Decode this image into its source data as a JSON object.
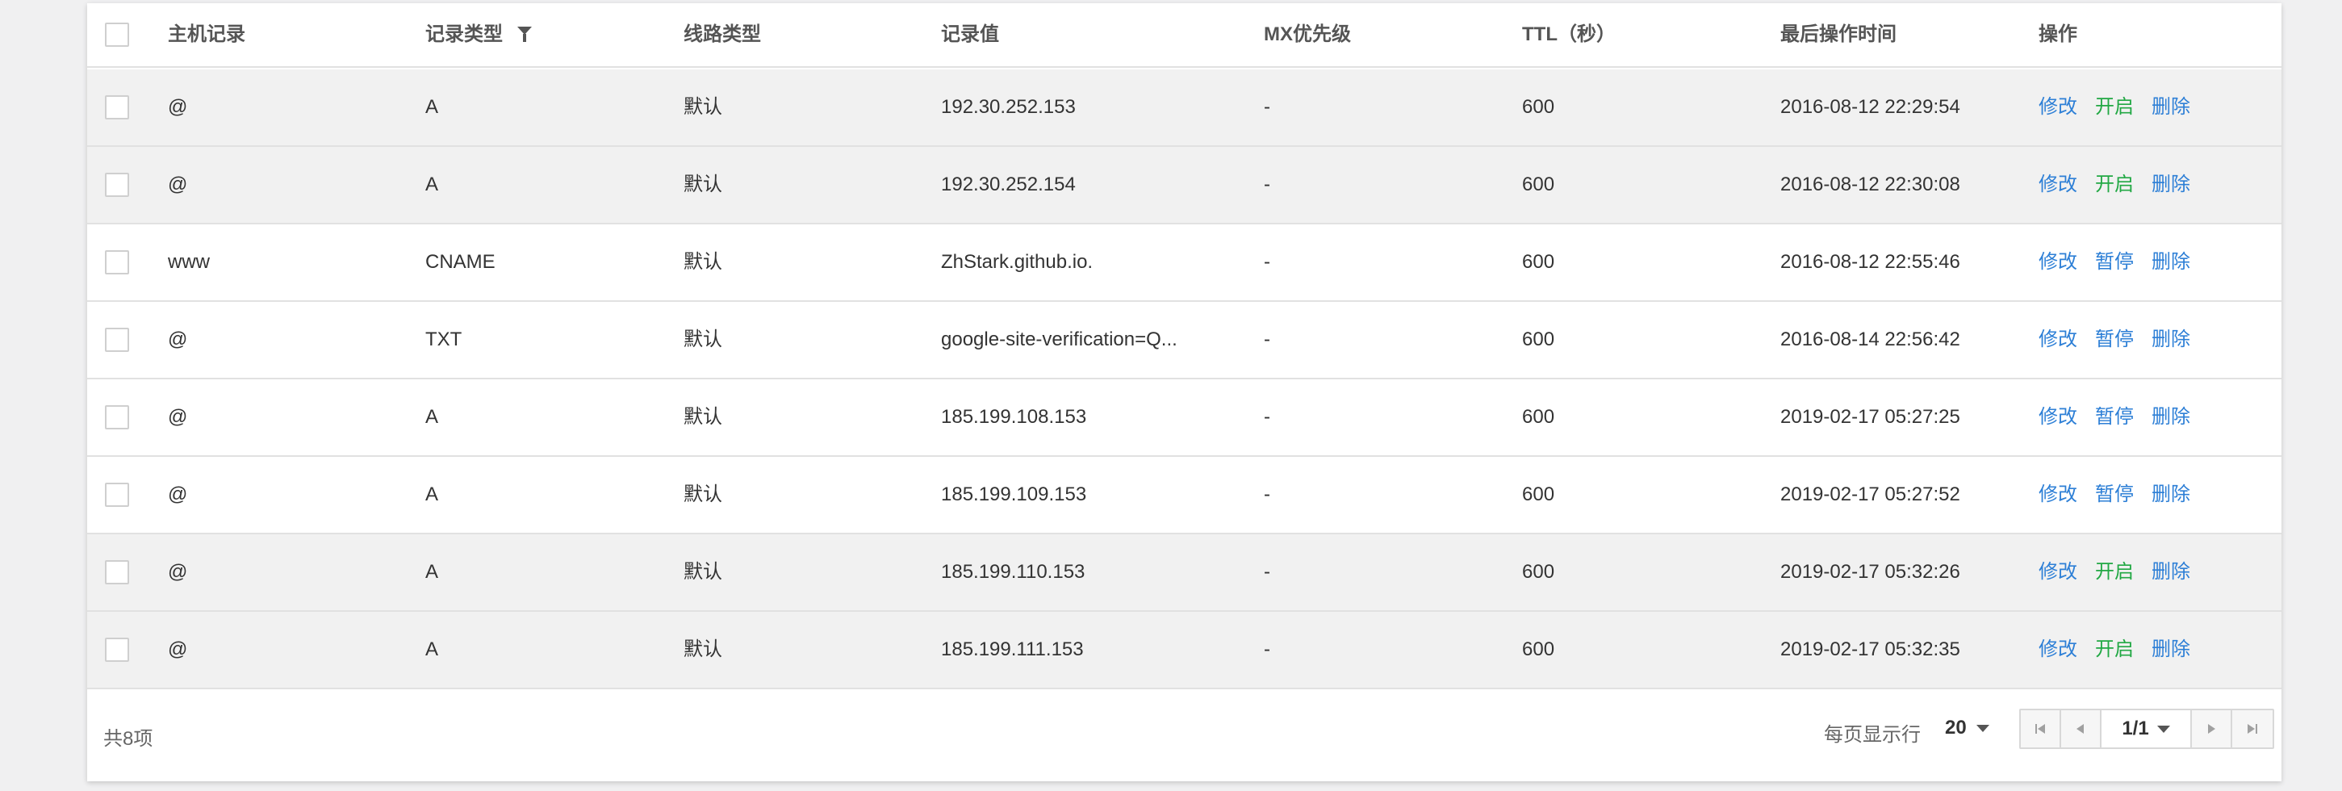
{
  "table": {
    "headers": {
      "host": "主机记录",
      "type": "记录类型",
      "line": "线路类型",
      "value": "记录值",
      "mx": "MX优先级",
      "ttl": "TTL（秒）",
      "time": "最后操作时间",
      "ops": "操作"
    },
    "rows": [
      {
        "host": "@",
        "type": "A",
        "line": "默认",
        "value": "192.30.252.153",
        "mx": "-",
        "ttl": "600",
        "time": "2016-08-12 22:29:54",
        "edit": "修改",
        "toggle": "开启",
        "toggle_kind": "enable",
        "delete": "删除",
        "paused": true
      },
      {
        "host": "@",
        "type": "A",
        "line": "默认",
        "value": "192.30.252.154",
        "mx": "-",
        "ttl": "600",
        "time": "2016-08-12 22:30:08",
        "edit": "修改",
        "toggle": "开启",
        "toggle_kind": "enable",
        "delete": "删除",
        "paused": true
      },
      {
        "host": "www",
        "type": "CNAME",
        "line": "默认",
        "value": "ZhStark.github.io.",
        "mx": "-",
        "ttl": "600",
        "time": "2016-08-12 22:55:46",
        "edit": "修改",
        "toggle": "暂停",
        "toggle_kind": "pause",
        "delete": "删除",
        "paused": false
      },
      {
        "host": "@",
        "type": "TXT",
        "line": "默认",
        "value": "google-site-verification=Q...",
        "mx": "-",
        "ttl": "600",
        "time": "2016-08-14 22:56:42",
        "edit": "修改",
        "toggle": "暂停",
        "toggle_kind": "pause",
        "delete": "删除",
        "paused": false
      },
      {
        "host": "@",
        "type": "A",
        "line": "默认",
        "value": "185.199.108.153",
        "mx": "-",
        "ttl": "600",
        "time": "2019-02-17 05:27:25",
        "edit": "修改",
        "toggle": "暂停",
        "toggle_kind": "pause",
        "delete": "删除",
        "paused": false
      },
      {
        "host": "@",
        "type": "A",
        "line": "默认",
        "value": "185.199.109.153",
        "mx": "-",
        "ttl": "600",
        "time": "2019-02-17 05:27:52",
        "edit": "修改",
        "toggle": "暂停",
        "toggle_kind": "pause",
        "delete": "删除",
        "paused": false
      },
      {
        "host": "@",
        "type": "A",
        "line": "默认",
        "value": "185.199.110.153",
        "mx": "-",
        "ttl": "600",
        "time": "2019-02-17 05:32:26",
        "edit": "修改",
        "toggle": "开启",
        "toggle_kind": "enable",
        "delete": "删除",
        "paused": true
      },
      {
        "host": "@",
        "type": "A",
        "line": "默认",
        "value": "185.199.111.153",
        "mx": "-",
        "ttl": "600",
        "time": "2019-02-17 05:32:35",
        "edit": "修改",
        "toggle": "开启",
        "toggle_kind": "enable",
        "delete": "删除",
        "paused": true
      }
    ]
  },
  "footer": {
    "total": "共8项",
    "per_page_label": "每页显示行",
    "per_page_value": "20",
    "page_indicator": "1/1"
  },
  "colors": {
    "link_blue": "#2d7fd6",
    "enable_green": "#22a844",
    "paused_row_bg": "#f1f1f1",
    "active_row_bg": "#ffffff"
  },
  "icons": {
    "filter": "filter-icon",
    "first_page": "first-page-icon",
    "prev_page": "prev-page-icon",
    "next_page": "next-page-icon",
    "last_page": "last-page-icon",
    "dropdown": "chevron-down-icon"
  }
}
